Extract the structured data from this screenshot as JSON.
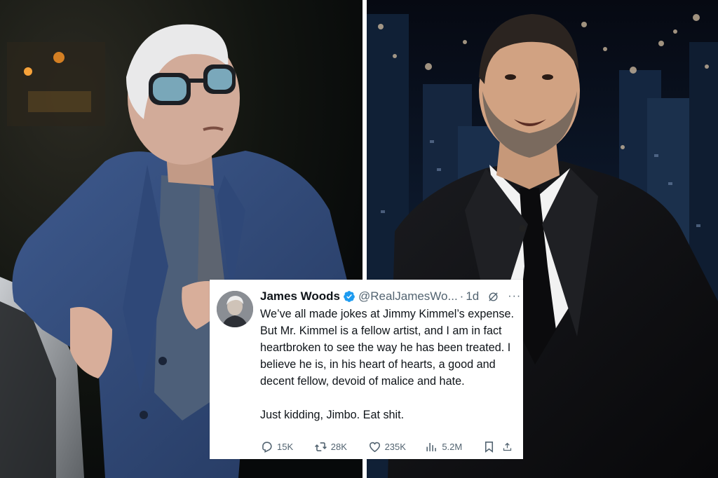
{
  "tweet": {
    "display_name": "James Woods",
    "handle": "@RealJamesWo...",
    "separator": "·",
    "time": "1d",
    "more_glyph": "···",
    "body": [
      "We’ve all made jokes at Jimmy Kimmel’s expense. But Mr. Kimmel is a fellow artist, and I am in fact heartbroken to see the way he has been treated. I believe he is, in his heart of hearts, a good and decent fellow, devoid of malice and hate.",
      "Just kidding, Jimbo. Eat shit."
    ],
    "stats": {
      "replies": "15K",
      "retweets": "28K",
      "likes": "235K",
      "views": "5.2M"
    },
    "icons": [
      "verified-badge-icon",
      "grok-icon",
      "more-icon",
      "reply-icon",
      "retweet-icon",
      "like-icon",
      "views-icon",
      "bookmark-icon",
      "share-icon"
    ]
  },
  "colors": {
    "verified_blue": "#1d9bf0",
    "text_primary": "#0f1419",
    "text_secondary": "#536471",
    "divider": "#ffffff"
  }
}
